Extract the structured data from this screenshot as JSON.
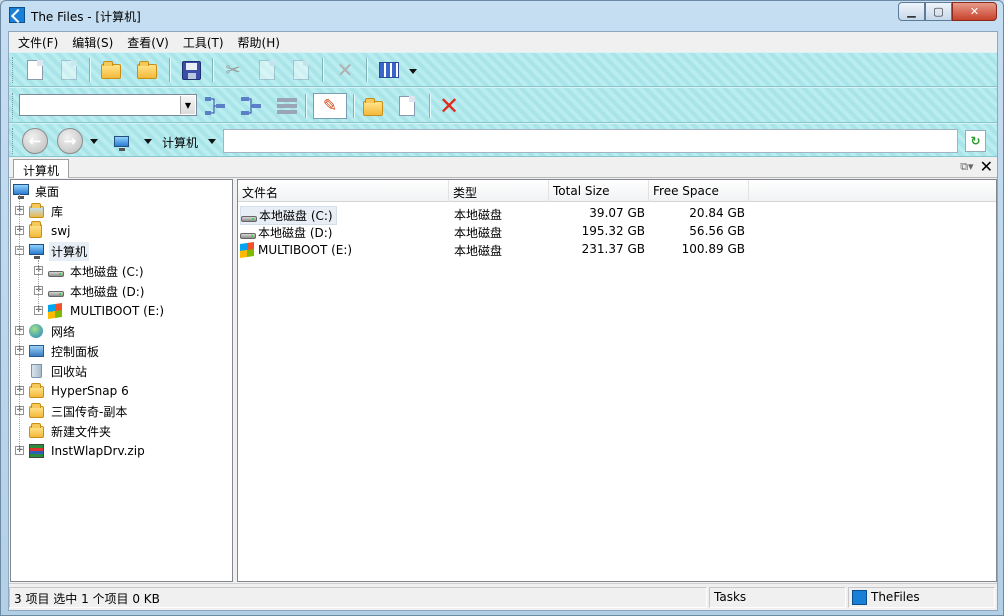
{
  "window": {
    "title": "The Files - [计算机]",
    "minimize": "▁",
    "maximize": "▢",
    "close": "✕"
  },
  "menu": [
    "文件(F)",
    "编辑(S)",
    "查看(V)",
    "工具(T)",
    "帮助(H)"
  ],
  "address": {
    "label": "计算机",
    "value": ""
  },
  "tab": {
    "label": "计算机",
    "close": "✕"
  },
  "tree": [
    {
      "label": "桌面",
      "icon": "desktop-icon",
      "level": 0,
      "expander": ""
    },
    {
      "label": "库",
      "icon": "library-icon",
      "level": 1,
      "expander": "+"
    },
    {
      "label": "swj",
      "icon": "user-folder-icon",
      "level": 1,
      "expander": "+"
    },
    {
      "label": "计算机",
      "icon": "computer-icon",
      "level": 1,
      "expander": "-",
      "selected": true
    },
    {
      "label": "本地磁盘 (C:)",
      "icon": "drive-icon",
      "level": 2,
      "expander": "+"
    },
    {
      "label": "本地磁盘 (D:)",
      "icon": "drive-icon",
      "level": 2,
      "expander": "+"
    },
    {
      "label": "MULTIBOOT (E:)",
      "icon": "windows-drive-icon",
      "level": 2,
      "expander": "+"
    },
    {
      "label": "网络",
      "icon": "network-icon",
      "level": 1,
      "expander": "+"
    },
    {
      "label": "控制面板",
      "icon": "control-panel-icon",
      "level": 1,
      "expander": "+"
    },
    {
      "label": "回收站",
      "icon": "recycle-bin-icon",
      "level": 1,
      "expander": ""
    },
    {
      "label": "HyperSnap 6",
      "icon": "folder-icon",
      "level": 1,
      "expander": "+"
    },
    {
      "label": "三国传奇-副本",
      "icon": "folder-icon",
      "level": 1,
      "expander": "+"
    },
    {
      "label": "新建文件夹",
      "icon": "folder-icon",
      "level": 1,
      "expander": ""
    },
    {
      "label": "InstWlapDrv.zip",
      "icon": "zip-icon",
      "level": 1,
      "expander": "+"
    }
  ],
  "list": {
    "columns": [
      "文件名",
      "类型",
      "Total Size",
      "Free Space"
    ],
    "rows": [
      {
        "name": "本地磁盘 (C:)",
        "type": "本地磁盘",
        "total": "39.07 GB",
        "free": "20.84 GB",
        "icon": "drive-icon"
      },
      {
        "name": "本地磁盘 (D:)",
        "type": "本地磁盘",
        "total": "195.32 GB",
        "free": "56.56 GB",
        "icon": "drive-icon"
      },
      {
        "name": "MULTIBOOT (E:)",
        "type": "本地磁盘",
        "total": "231.37 GB",
        "free": "100.89 GB",
        "icon": "windows-drive-icon"
      }
    ]
  },
  "status": {
    "info": "3 项目 选中 1 个项目 0 KB",
    "tasks": "Tasks",
    "app": "TheFiles"
  },
  "colors": {
    "toolbar": "#b3e9ec",
    "close": "#c7422b",
    "title": "#c6def2"
  }
}
